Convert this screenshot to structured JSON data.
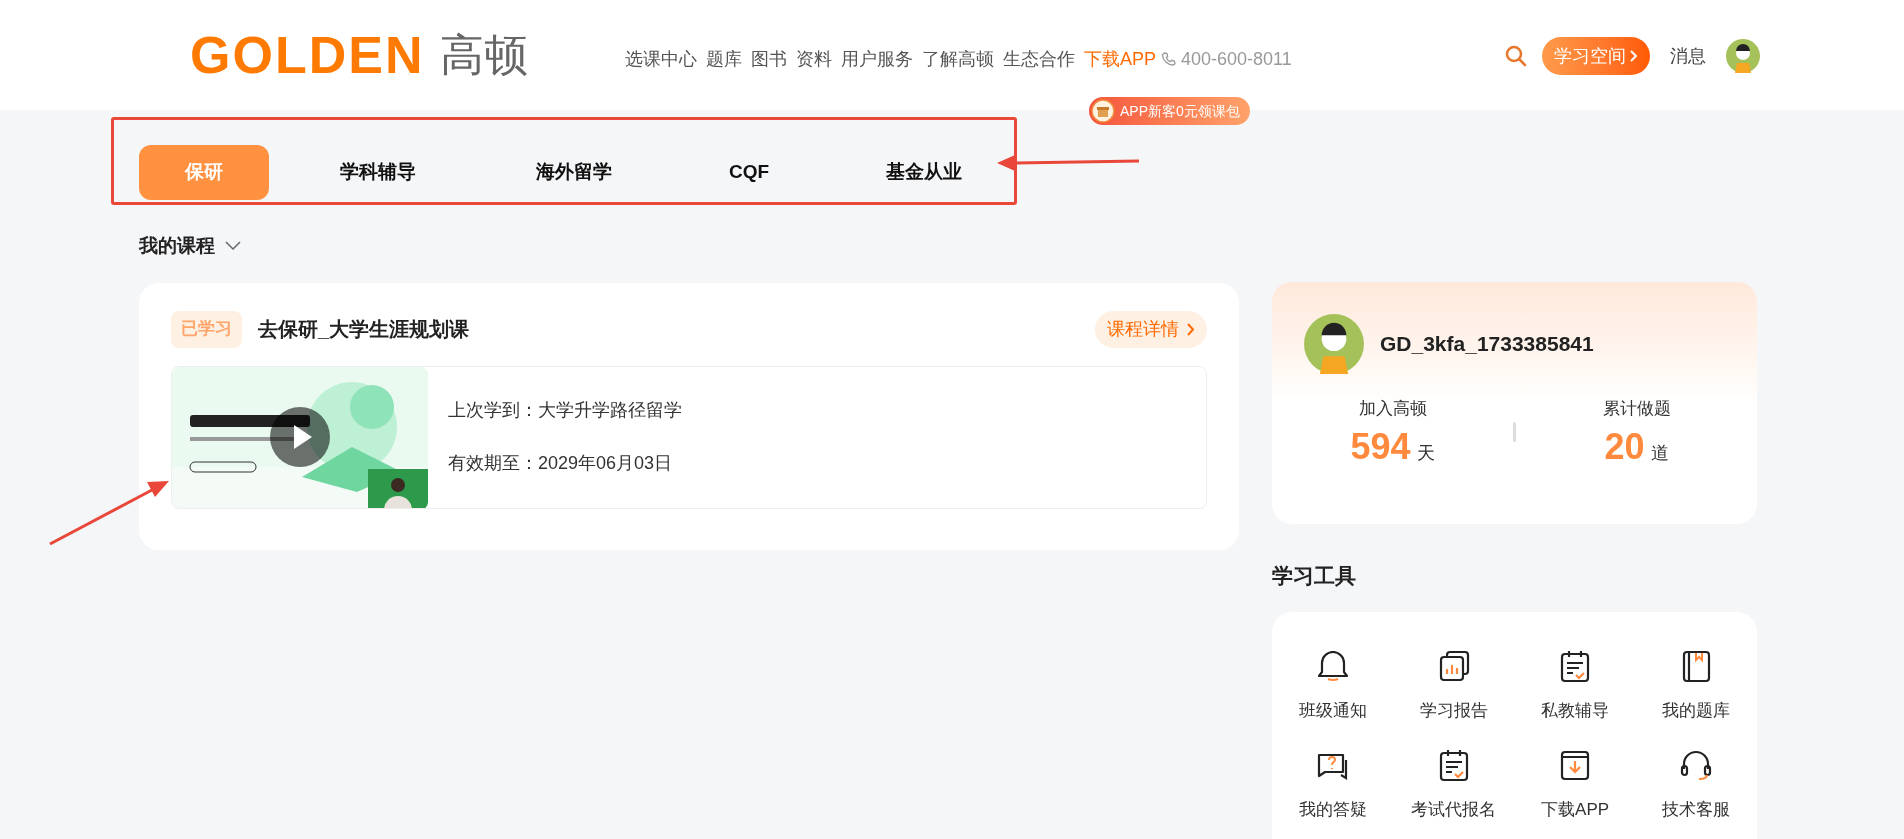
{
  "header": {
    "logo_text": "GOLDEN",
    "logo_chinese": "高顿",
    "nav": [
      {
        "label": "选课中心",
        "highlighted": false
      },
      {
        "label": "题库",
        "highlighted": false
      },
      {
        "label": "图书",
        "highlighted": false
      },
      {
        "label": "资料",
        "highlighted": false
      },
      {
        "label": "用户服务",
        "highlighted": false
      },
      {
        "label": "了解高顿",
        "highlighted": false
      },
      {
        "label": "生态合作",
        "highlighted": false
      },
      {
        "label": "下载APP",
        "highlighted": true
      }
    ],
    "phone": "400-600-8011",
    "promo_badge": "APP新客0元领课包",
    "study_button": "学习空间",
    "messages": "消息"
  },
  "tabs": [
    {
      "label": "保研",
      "selected": true
    },
    {
      "label": "学科辅导",
      "selected": false
    },
    {
      "label": "海外留学",
      "selected": false
    },
    {
      "label": "CQF",
      "selected": false
    },
    {
      "label": "基金从业",
      "selected": false
    }
  ],
  "my_courses": {
    "title": "我的课程",
    "courses": [
      {
        "status": "已学习",
        "title": "去保研_大学生涯规划课",
        "details_button": "课程详情",
        "last_studied": "上次学到：大学升学路径留学",
        "valid_until": "有效期至：2029年06月03日"
      }
    ]
  },
  "profile": {
    "username": "GD_3kfa_1733385841",
    "stats": [
      {
        "label": "加入高顿",
        "value": "594",
        "unit": "天"
      },
      {
        "label": "累计做题",
        "value": "20",
        "unit": "道"
      }
    ]
  },
  "tools": {
    "title": "学习工具",
    "items": [
      {
        "label": "班级通知",
        "kind": "bell"
      },
      {
        "label": "学习报告",
        "kind": "report"
      },
      {
        "label": "私教辅导",
        "kind": "calendar"
      },
      {
        "label": "我的题库",
        "kind": "book"
      },
      {
        "label": "我的答疑",
        "kind": "question"
      },
      {
        "label": "考试代报名",
        "kind": "calendar"
      },
      {
        "label": "下载APP",
        "kind": "download"
      },
      {
        "label": "技术客服",
        "kind": "headset"
      }
    ]
  }
}
